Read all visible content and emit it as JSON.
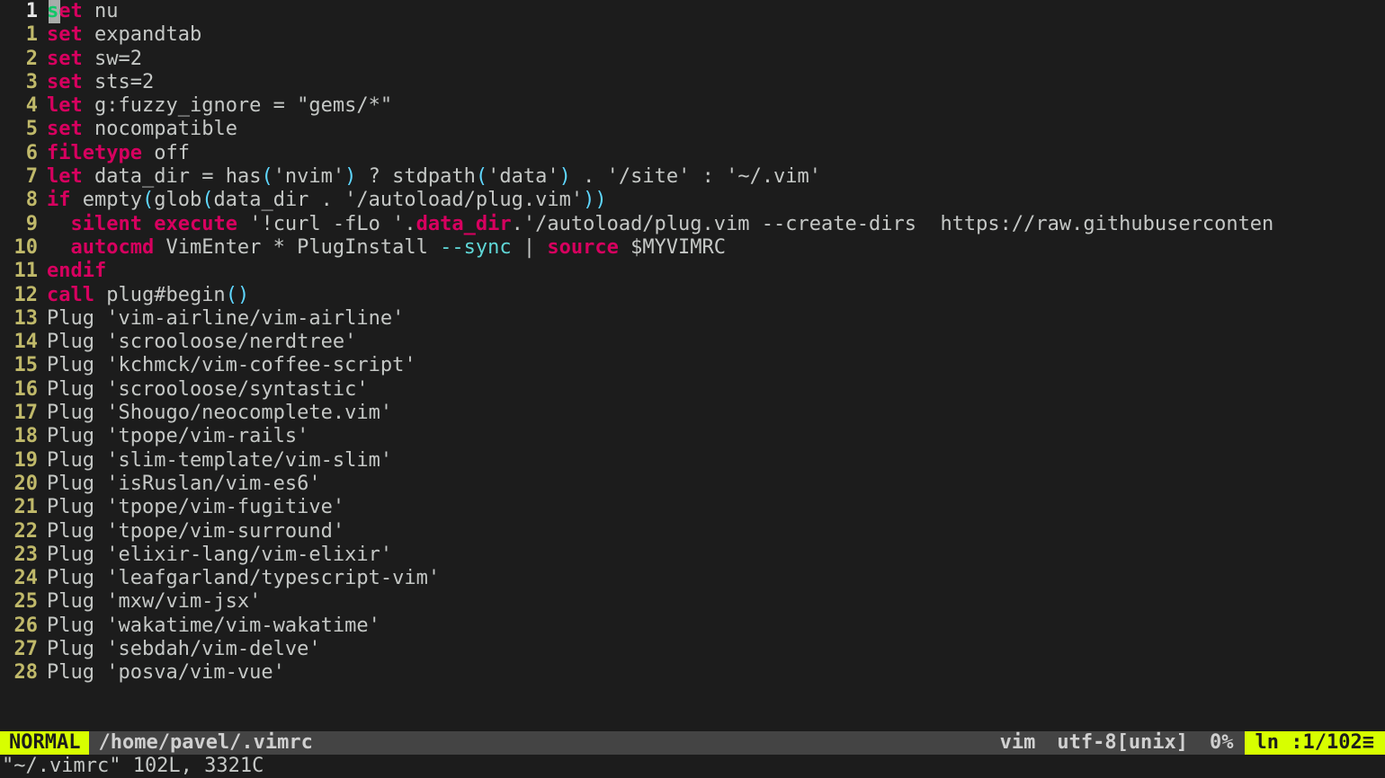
{
  "gutter": {
    "current": "1",
    "rel": [
      "1",
      "2",
      "3",
      "4",
      "5",
      "6",
      "7",
      "8",
      "9",
      "10",
      "11",
      "12",
      "13",
      "14",
      "15",
      "16",
      "17",
      "18",
      "19",
      "20",
      "21",
      "22",
      "23",
      "24",
      "25",
      "26",
      "27",
      "28"
    ]
  },
  "code": {
    "l0": {
      "kw": "set",
      "rest": " nu"
    },
    "l1": {
      "kw": "set",
      "rest": " expandtab"
    },
    "l2": {
      "kw": "set",
      "rest": " sw=2"
    },
    "l3": {
      "kw": "set",
      "rest": " sts=2"
    },
    "l4": {
      "kw": "let",
      "rest": " g:fuzzy_ignore = \"gems/*\""
    },
    "l5": {
      "kw": "set",
      "rest": " nocompatible"
    },
    "l6": {
      "kw": "filetype",
      "rest": " off"
    },
    "l7": {
      "kw": "let",
      "a": " data_dir ",
      "eq": "=",
      "b": " has",
      "p1": "(",
      "s1": "'nvim'",
      "p2": ")",
      "c": " ? stdpath",
      "p3": "(",
      "s2": "'data'",
      "p4": ")",
      "d": " . ",
      "s3": "'/site'",
      "e": " : ",
      "s4": "'~/.vim'"
    },
    "l8": {
      "kw": "if",
      "a": " empty",
      "p1": "(",
      "b": "glob",
      "p2": "(",
      "c": "data_dir . ",
      "s1": "'/autoload/plug.vim'",
      "p3": ")",
      ")": ")"
    },
    "l9": {
      "indent": "  ",
      "kw1": "silent",
      "sp": " ",
      "kw2": "execute",
      "a": " '!curl -fLo '",
      "dot": ".",
      "b": "data_dir",
      "dot2": ".",
      "c": "'/autoload/plug.vim --create-dirs  https://raw.githubuserconten"
    },
    "l10": {
      "indent": "  ",
      "kw": "autocmd",
      "a": " VimEnter * PlugInstall ",
      "opt": "--sync",
      "b": " | ",
      "kw2": "source",
      "c": " $MYVIMRC"
    },
    "l11": {
      "kw": "endif"
    },
    "l12": {
      "kw": "call",
      "a": " plug#begin",
      "p1": "(",
      ")": ")"
    },
    "l13": "Plug 'vim-airline/vim-airline'",
    "l14": "Plug 'scrooloose/nerdtree'",
    "l15": "Plug 'kchmck/vim-coffee-script'",
    "l16": "Plug 'scrooloose/syntastic'",
    "l17": "Plug 'Shougo/neocomplete.vim'",
    "l18": "Plug 'tpope/vim-rails'",
    "l19": "Plug 'slim-template/vim-slim'",
    "l20": "Plug 'isRuslan/vim-es6'",
    "l21": "Plug 'tpope/vim-fugitive'",
    "l22": "Plug 'tpope/vim-surround'",
    "l23": "Plug 'elixir-lang/vim-elixir'",
    "l24": "Plug 'leafgarland/typescript-vim'",
    "l25": "Plug 'mxw/vim-jsx'",
    "l26": "Plug 'wakatime/vim-wakatime'",
    "l27": "Plug 'sebdah/vim-delve'",
    "l28": "Plug 'posva/vim-vue'"
  },
  "status": {
    "mode": "NORMAL",
    "path": "/home/pavel/.vimrc",
    "filetype": "vim",
    "encoding": "utf-8[unix]",
    "percent": "0%",
    "position": "ln :1/102≡"
  },
  "cmdline": "\"~/.vimrc\" 102L, 3321C"
}
